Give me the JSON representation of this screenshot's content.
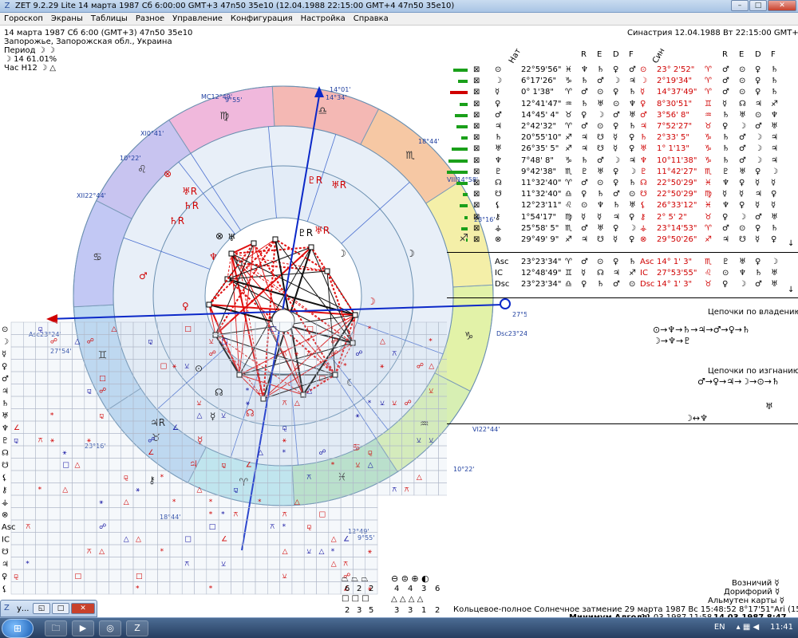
{
  "window": {
    "title": "ZET 9.2.29 Lite   14 марта 1987  Сб   6:00:00 GMT+3 47n50  35e10  (12.04.1988  22:15:00 GMT+4 47n50  35e10)",
    "min": "–",
    "max": "□",
    "close": "✕"
  },
  "menu": [
    "Гороскоп",
    "Экраны",
    "Таблицы",
    "Разное",
    "Управление",
    "Конфигурация",
    "Настройка",
    "Справка"
  ],
  "info": {
    "line1": "14 марта 1987  Сб   6:00 (GMT+3) 47n50  35e10",
    "line2": "Запорожье, Запорожская обл., Украина",
    "line3": "Период ☽ ☽",
    "line4": "☽  14 61.01%",
    "line5": "Час Н12 ☽ △",
    "synastry": "Синастрия 12.04.1988  Вт 22:15:00 GMT+4"
  },
  "wheel": {
    "mc_label": "MC",
    "mc_deg": "12°49'",
    "mc_min": "9°55'",
    "top_a": "14°01'",
    "top_b": "14°34'",
    "asc_label": "Asc",
    "asc_deg": "23°24'",
    "asc_small": "27°54'",
    "dsc_label": "Dsc",
    "dsc_deg": "23°24'",
    "dsc_small": "27°54'",
    "h11": "XI",
    "h11_deg": "0°41'",
    "h12": "XII",
    "h12_deg": "22°44'",
    "h8": "VIII",
    "h8_deg": "14°58'",
    "h6": "VI",
    "h6_deg": "22°44'",
    "h10_small": "10°22'",
    "h9_small": "18°44'",
    "h5_small": "10°22'",
    "h3_small": "18°44'",
    "h12_small": "23°16'",
    "h8_small": "23°16'",
    "ic_a": "12°49'",
    "ic_b": "9°55'",
    "signs": [
      "♐",
      "♏",
      "♎",
      "♍",
      "♌",
      "♋",
      "♊",
      "♉",
      "♈",
      "♓",
      "♒",
      "♑"
    ]
  },
  "table": {
    "hdr_left": "Нат",
    "hdr_right": "Син",
    "cols": [
      "R",
      "E",
      "D",
      "F"
    ],
    "rows": [
      {
        "a": "⊙",
        "d1": "22°59'56\"",
        "s1": "♓",
        "r1": "♆",
        "e1": "♄",
        "dd1": "♀",
        "f1": "♂",
        "b": "⊙",
        "d2": "23° 2'52\"",
        "s2": "♈",
        "r2": "♂",
        "e2": "⊙",
        "dd2": "♀",
        "f2": "♄"
      },
      {
        "a": "☽",
        "d1": "6°17'26\"",
        "s1": "♑",
        "r1": "♄",
        "e1": "♂",
        "dd1": "☽",
        "f1": "♃",
        "b": "☽",
        "d2": "2°19'34\"",
        "s2": "♈",
        "r2": "♂",
        "e2": "⊙",
        "dd2": "♀",
        "f2": "♄"
      },
      {
        "a": "☿",
        "d1": "0° 1'38\"",
        "s1": "♈",
        "r1": "♂",
        "e1": "⊙",
        "dd1": "♀",
        "f1": "♄",
        "b": "☿",
        "d2": "14°37'49\"",
        "s2": "♈",
        "r2": "♂",
        "e2": "⊙",
        "dd2": "♀",
        "f2": "♄"
      },
      {
        "a": "♀",
        "d1": "12°41'47\"",
        "s1": "♒",
        "r1": "♄",
        "e1": "♅",
        "dd1": "⊙",
        "f1": "♆",
        "b": "♀",
        "d2": "8°30'51\"",
        "s2": "♊",
        "r2": "☿",
        "e2": "☊",
        "dd2": "♃",
        "f2": "♐"
      },
      {
        "a": "♂",
        "d1": "14°45' 4\"",
        "s1": "♉",
        "r1": "♀",
        "e1": "☽",
        "dd1": "♂",
        "f1": "♅",
        "b": "♂",
        "d2": "3°56' 8\"",
        "s2": "♒",
        "r2": "♄",
        "e2": "♅",
        "dd2": "⊙",
        "f2": "♆"
      },
      {
        "a": "♃",
        "d1": "2°42'32\"",
        "s1": "♈",
        "r1": "♂",
        "e1": "⊙",
        "dd1": "♀",
        "f1": "♄",
        "b": "♃",
        "d2": "7°52'27\"",
        "s2": "♉",
        "r2": "♀",
        "e2": "☽",
        "dd2": "♂",
        "f2": "♅"
      },
      {
        "a": "♄",
        "d1": "20°55'10\"",
        "s1": "♐",
        "r1": "♃",
        "e1": "☋",
        "dd1": "☿",
        "f1": "♀",
        "b": "♄",
        "d2": "2°33' 5\"",
        "s2": "♑",
        "r2": "♄",
        "e2": "♂",
        "dd2": "☽",
        "f2": "♃"
      },
      {
        "a": "♅",
        "d1": "26°35' 5\"",
        "s1": "♐",
        "r1": "♃",
        "e1": "☋",
        "dd1": "☿",
        "f1": "♀",
        "b": "♅",
        "d2": "1° 1'13\"",
        "s2": "♑",
        "r2": "♄",
        "e2": "♂",
        "dd2": "☽",
        "f2": "♃"
      },
      {
        "a": "♆",
        "d1": "7°48' 8\"",
        "s1": "♑",
        "r1": "♄",
        "e1": "♂",
        "dd1": "☽",
        "f1": "♃",
        "b": "♆",
        "d2": "10°11'38\"",
        "s2": "♑",
        "r2": "♄",
        "e2": "♂",
        "dd2": "☽",
        "f2": "♃"
      },
      {
        "a": "♇",
        "d1": "9°42'38\"",
        "s1": "♏",
        "r1": "♇",
        "e1": "♅",
        "dd1": "♀",
        "f1": "☽",
        "b": "♇",
        "d2": "11°42'27\"",
        "s2": "♏",
        "r2": "♇",
        "e2": "♅",
        "dd2": "♀",
        "f2": "☽"
      },
      {
        "a": "☊",
        "d1": "11°32'40\"",
        "s1": "♈",
        "r1": "♂",
        "e1": "⊙",
        "dd1": "♀",
        "f1": "♄",
        "b": "☊",
        "d2": "22°50'29\"",
        "s2": "♓",
        "r2": "♆",
        "e2": "♀",
        "dd2": "☿",
        "f2": "☿"
      },
      {
        "a": "☋",
        "d1": "11°32'40\"",
        "s1": "♎",
        "r1": "♀",
        "e1": "♄",
        "dd1": "♂",
        "f1": "⊙",
        "b": "☋",
        "d2": "22°50'29\"",
        "s2": "♍",
        "r2": "☿",
        "e2": "☿",
        "dd2": "♃",
        "f2": "♀"
      },
      {
        "a": "⚸",
        "d1": "12°23'11\"",
        "s1": "♌",
        "r1": "⊙",
        "e1": "♆",
        "dd1": "♄",
        "f1": "♅",
        "b": "⚸",
        "d2": "26°33'12\"",
        "s2": "♓",
        "r2": "♆",
        "e2": "♀",
        "dd2": "☿",
        "f2": "☿"
      },
      {
        "a": "⚷",
        "d1": "1°54'17\"",
        "s1": "♍",
        "r1": "☿",
        "e1": "☿",
        "dd1": "♃",
        "f1": "♀",
        "b": "⚷",
        "d2": "2° 5' 2\"",
        "s2": "♉",
        "r2": "♀",
        "e2": "☽",
        "dd2": "♂",
        "f2": "♅"
      },
      {
        "a": "⚶",
        "d1": "25°58' 5\"",
        "s1": "♏",
        "r1": "♂",
        "e1": "♅",
        "dd1": "♀",
        "f1": "☽",
        "b": "⚶",
        "d2": "23°14'53\"",
        "s2": "♈",
        "r2": "♂",
        "e2": "⊙",
        "dd2": "♀",
        "f2": "♄"
      },
      {
        "a": "⊗",
        "d1": "29°49' 9\"",
        "s1": "♐",
        "r1": "♃",
        "e1": "☋",
        "dd1": "☿",
        "f1": "♀",
        "b": "⊗",
        "d2": "29°50'26\"",
        "s2": "♐",
        "r2": "♃",
        "e2": "☋",
        "dd2": "☿",
        "f2": "♀"
      }
    ],
    "angles": [
      {
        "a": "Asc",
        "d1": "23°23'34\"",
        "s1": "♈",
        "r1": "♂",
        "e1": "⊙",
        "dd1": "♀",
        "f1": "♄",
        "b": "Asc",
        "d2": "14° 1' 3\"",
        "s2": "♏",
        "r2": "♇",
        "e2": "♅",
        "dd2": "♀",
        "f2": "☽"
      },
      {
        "a": "IC",
        "d1": "12°48'49\"",
        "s1": "♊",
        "r1": "☿",
        "e1": "☊",
        "dd1": "♃",
        "f1": "♐",
        "b": "IC",
        "d2": "27°53'55\"",
        "s2": "♌",
        "r2": "⊙",
        "e2": "♆",
        "dd2": "♄",
        "f2": "♅"
      },
      {
        "a": "Dsc",
        "d1": "23°23'34\"",
        "s1": "♎",
        "r1": "♀",
        "e1": "♄",
        "dd1": "♂",
        "f1": "⊙",
        "b": "Dsc",
        "d2": "14° 1' 3\"",
        "s2": "♉",
        "r2": "♀",
        "e2": "☽",
        "dd2": "♂",
        "f2": "♅"
      }
    ]
  },
  "chains": {
    "own_title": "Цепочки по владению",
    "own_line1": "⊙→♆→♄→♃→♂→♀→♄",
    "own_line2": "☽→♆→♇",
    "exile_title": "Цепочки по изгнанию",
    "exile_line1": "♂→♀→♃→☽→⊙→♄",
    "exile_line2": "♅",
    "moon_nep": "☽↔♆"
  },
  "bottom": {
    "l1": "Возничий",
    "l2": "Дорифорий",
    "l3": "Альмутен карты",
    "eclipse": "Кольцевое-полное Солнечное затмение 29 марта 1987 Вс 15:48:52  8°17'51\"Ari (15 дней)",
    "algol_label": "Минимум Алголя:",
    "algol_v1": "11.03.1987 11:58,",
    "algol_v2": "14.03.1987  8:47",
    "counts1": [
      "6",
      "2",
      "2"
    ],
    "counts2": [
      "2",
      "3",
      "5"
    ],
    "counts3": [
      "4",
      "4",
      "3",
      "6"
    ],
    "counts4": [
      "3",
      "3",
      "1",
      "2"
    ]
  },
  "taskbar": {
    "win_label": "у...",
    "lang": "EN",
    "clock": "11:41"
  }
}
